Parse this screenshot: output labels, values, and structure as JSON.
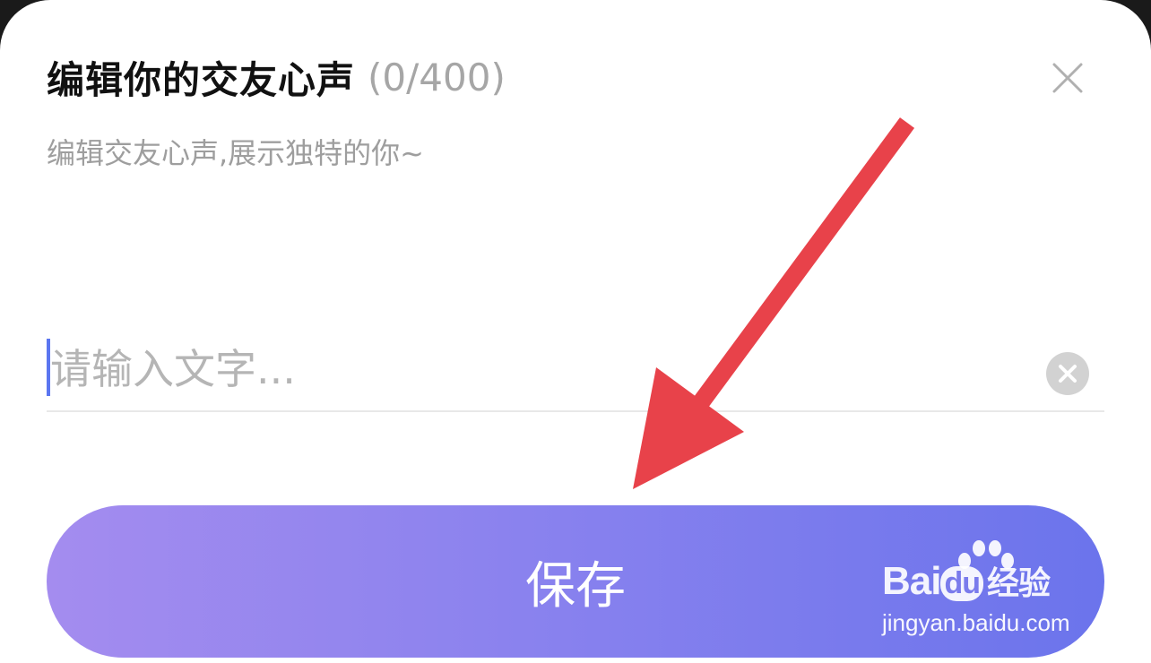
{
  "dialog": {
    "title": "编辑你的交友心声",
    "counter": "(0/400)",
    "subtitle": "编辑交友心声,展示独特的你~",
    "close_icon": "close-icon"
  },
  "input": {
    "placeholder": "请输入文字...",
    "value": "",
    "clear_icon": "clear-circle-icon"
  },
  "save_button": {
    "label": "保存"
  },
  "annotation": {
    "arrow_color": "#e8424a"
  },
  "watermark": {
    "brand_left": "Bai",
    "brand_mid": "du",
    "brand_right": "经验",
    "url": "jingyan.baidu.com"
  },
  "colors": {
    "button_gradient_start": "#a48cef",
    "button_gradient_end": "#6b74ec",
    "caret": "#5b76f0"
  }
}
